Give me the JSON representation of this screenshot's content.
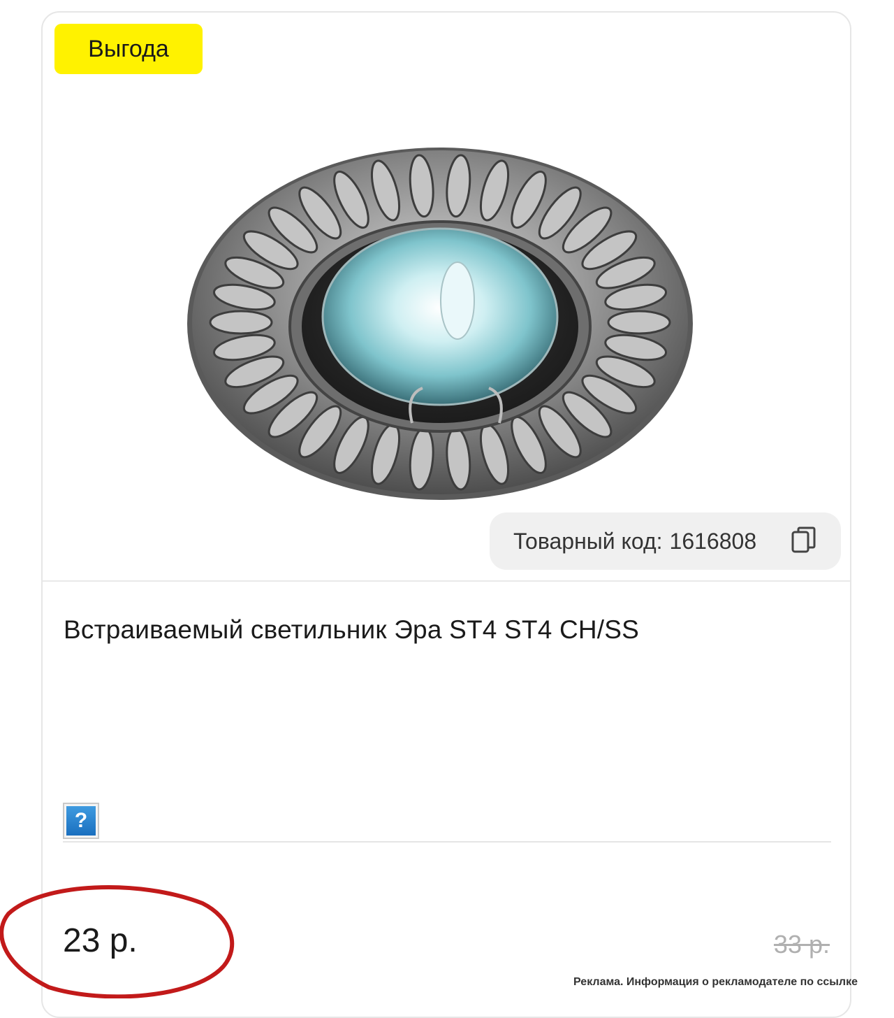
{
  "badge": {
    "label": "Выгода",
    "color": "#fff200"
  },
  "product": {
    "image_icon": "recessed-ceiling-light-image",
    "code_label": "Товарный код:",
    "code_value": "1616808",
    "copy_icon": "copy-icon",
    "title": "Встраиваемый светильник Эра ST4 ST4 CH/SS",
    "help_icon": "question-mark-icon",
    "help_symbol": "?"
  },
  "pricing": {
    "price": "23 р.",
    "old_price": "33 р.",
    "highlight_color": "#c21a1a"
  },
  "footer": {
    "ad_note": "Реклама. Информация о рекламодателе по ссылке"
  }
}
